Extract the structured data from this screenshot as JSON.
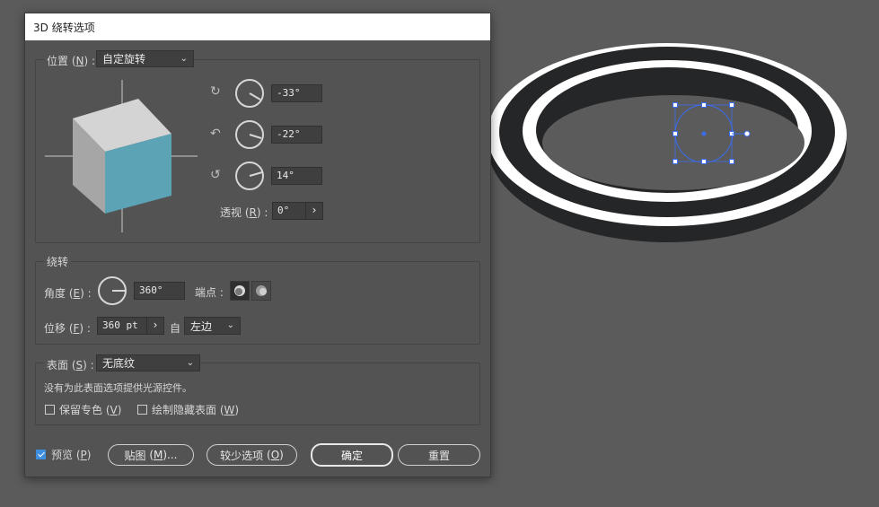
{
  "dialog": {
    "title": "3D 绕转选项",
    "position": {
      "label": "位置",
      "key": "N",
      "value": "自定旋转",
      "rotations": [
        "-33°",
        "-22°",
        "14°"
      ],
      "perspective_label": "透视",
      "perspective_key": "R",
      "perspective_value": "0°"
    },
    "revolve": {
      "label": "绕转",
      "angle_label": "角度",
      "angle_key": "E",
      "angle_value": "360°",
      "cap_label": "端点",
      "offset_label": "位移",
      "offset_key": "F",
      "offset_value": "360 pt",
      "from_label": "自",
      "from_value": "左边"
    },
    "surface": {
      "label": "表面",
      "key": "S",
      "value": "无底纹",
      "note": "没有为此表面选项提供光源控件。",
      "preserve_spot": "保留专色",
      "preserve_key": "V",
      "draw_hidden": "绘制隐藏表面",
      "draw_hidden_key": "W"
    },
    "footer": {
      "preview_label": "预览",
      "preview_key": "P",
      "preview_checked": true,
      "map_button": "贴图",
      "map_key": "M",
      "map_suffix": "...",
      "fewer_options": "较少选项",
      "fewer_key": "O",
      "ok": "确定",
      "reset": "重置"
    }
  },
  "colors": {
    "cube_front": "#5ba3b5",
    "cube_top": "#d4d4d4",
    "cube_side": "#a6a6a6",
    "selection": "#3b6cf0",
    "torus_dark": "#252628",
    "torus_light": "#ffffff"
  }
}
